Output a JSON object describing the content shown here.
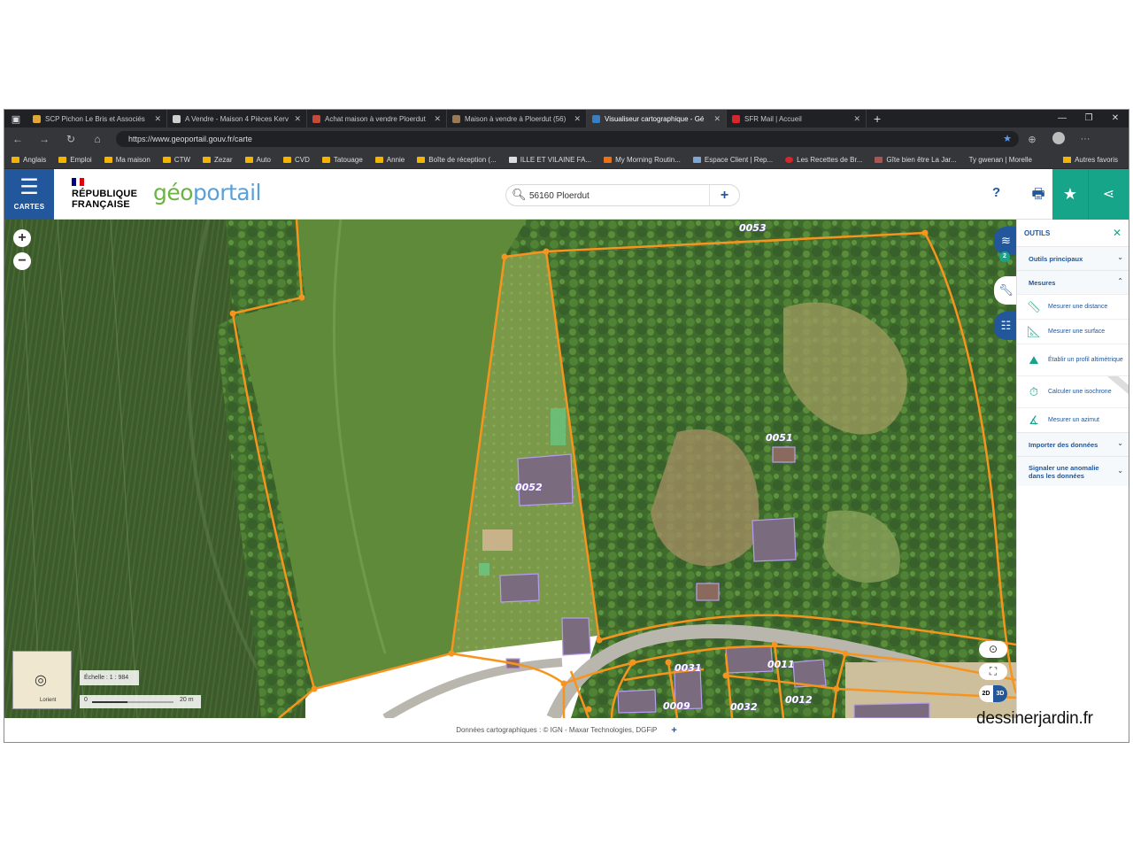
{
  "browser": {
    "tabs": [
      {
        "title": "SCP Pichon Le Bris et Associés",
        "favicon_color": "#e2a634",
        "active": false
      },
      {
        "title": "A Vendre - Maison 4 Pièces Kerv",
        "favicon_color": "#cfcfcf",
        "active": false
      },
      {
        "title": "Achat maison à vendre Ploerdut",
        "favicon_color": "#c44b3a",
        "active": false
      },
      {
        "title": "Maison à vendre à Ploerdut (56)",
        "favicon_color": "#9a7a55",
        "active": false
      },
      {
        "title": "Visualiseur cartographique - Gé",
        "favicon_color": "#3a7ec2",
        "active": true
      },
      {
        "title": "SFR Mail | Accueil",
        "favicon_color": "#d9262c",
        "active": false
      }
    ],
    "url": "https://www.geoportail.gouv.fr/carte",
    "bookmarks": [
      "Anglais",
      "Emploi",
      "Ma maison",
      "CTW",
      "Zezar",
      "Auto",
      "CVD",
      "Tatouage",
      "Annie",
      "Boîte de réception (...",
      "ILLE ET VILAINE FA...",
      "My Morning Routin...",
      "Espace Client | Rep...",
      "Les Recettes de Br...",
      "Gîte bien être La Jar...",
      "Ty gwenan | Morelle"
    ],
    "bookmarks_other": "Autres favoris"
  },
  "header": {
    "menu_label": "CARTES",
    "republique": "RÉPUBLIQUE",
    "francaise": "FRANÇAISE",
    "logo_geo": "géo",
    "logo_portail": "portail",
    "search_value": "56160 Ploerdut",
    "search_add": "+",
    "help": "?"
  },
  "map": {
    "parcels": [
      "0053",
      "0052",
      "0051",
      "0031",
      "0011",
      "0009",
      "0032",
      "0012"
    ],
    "scale_text": "Échelle : 1 : 984",
    "scale_min": "0",
    "scale_max": "20 m",
    "minimap_city": "Lorient",
    "view_2d": "2D",
    "view_3d": "3D",
    "layers_count": "2",
    "colors": {
      "parcel": "#f7941d",
      "building": "#a78bfa",
      "label": "#8b5cf6"
    }
  },
  "tools": {
    "title": "OUTILS",
    "sections": [
      {
        "label": "Outils principaux",
        "expanded": false
      },
      {
        "label": "Mesures",
        "expanded": true
      },
      {
        "label": "Importer des données",
        "expanded": false
      },
      {
        "label": "Signaler une anomalie dans les données",
        "expanded": false
      }
    ],
    "measure_tools": [
      {
        "label": "Mesurer une distance",
        "icon": "ruler-icon"
      },
      {
        "label": "Mesurer une surface",
        "icon": "ruler-area-icon"
      },
      {
        "label": "Établir un profil altimétrique",
        "icon": "profile-icon"
      },
      {
        "label": "Calculer une isochrone",
        "icon": "stopwatch-icon"
      },
      {
        "label": "Mesurer un azimut",
        "icon": "azimuth-icon"
      }
    ]
  },
  "footer": {
    "attribution": "Données cartographiques : © IGN - Maxar Technologies, DGFiP",
    "add": "+"
  },
  "watermark": "dessinerjardin.fr"
}
